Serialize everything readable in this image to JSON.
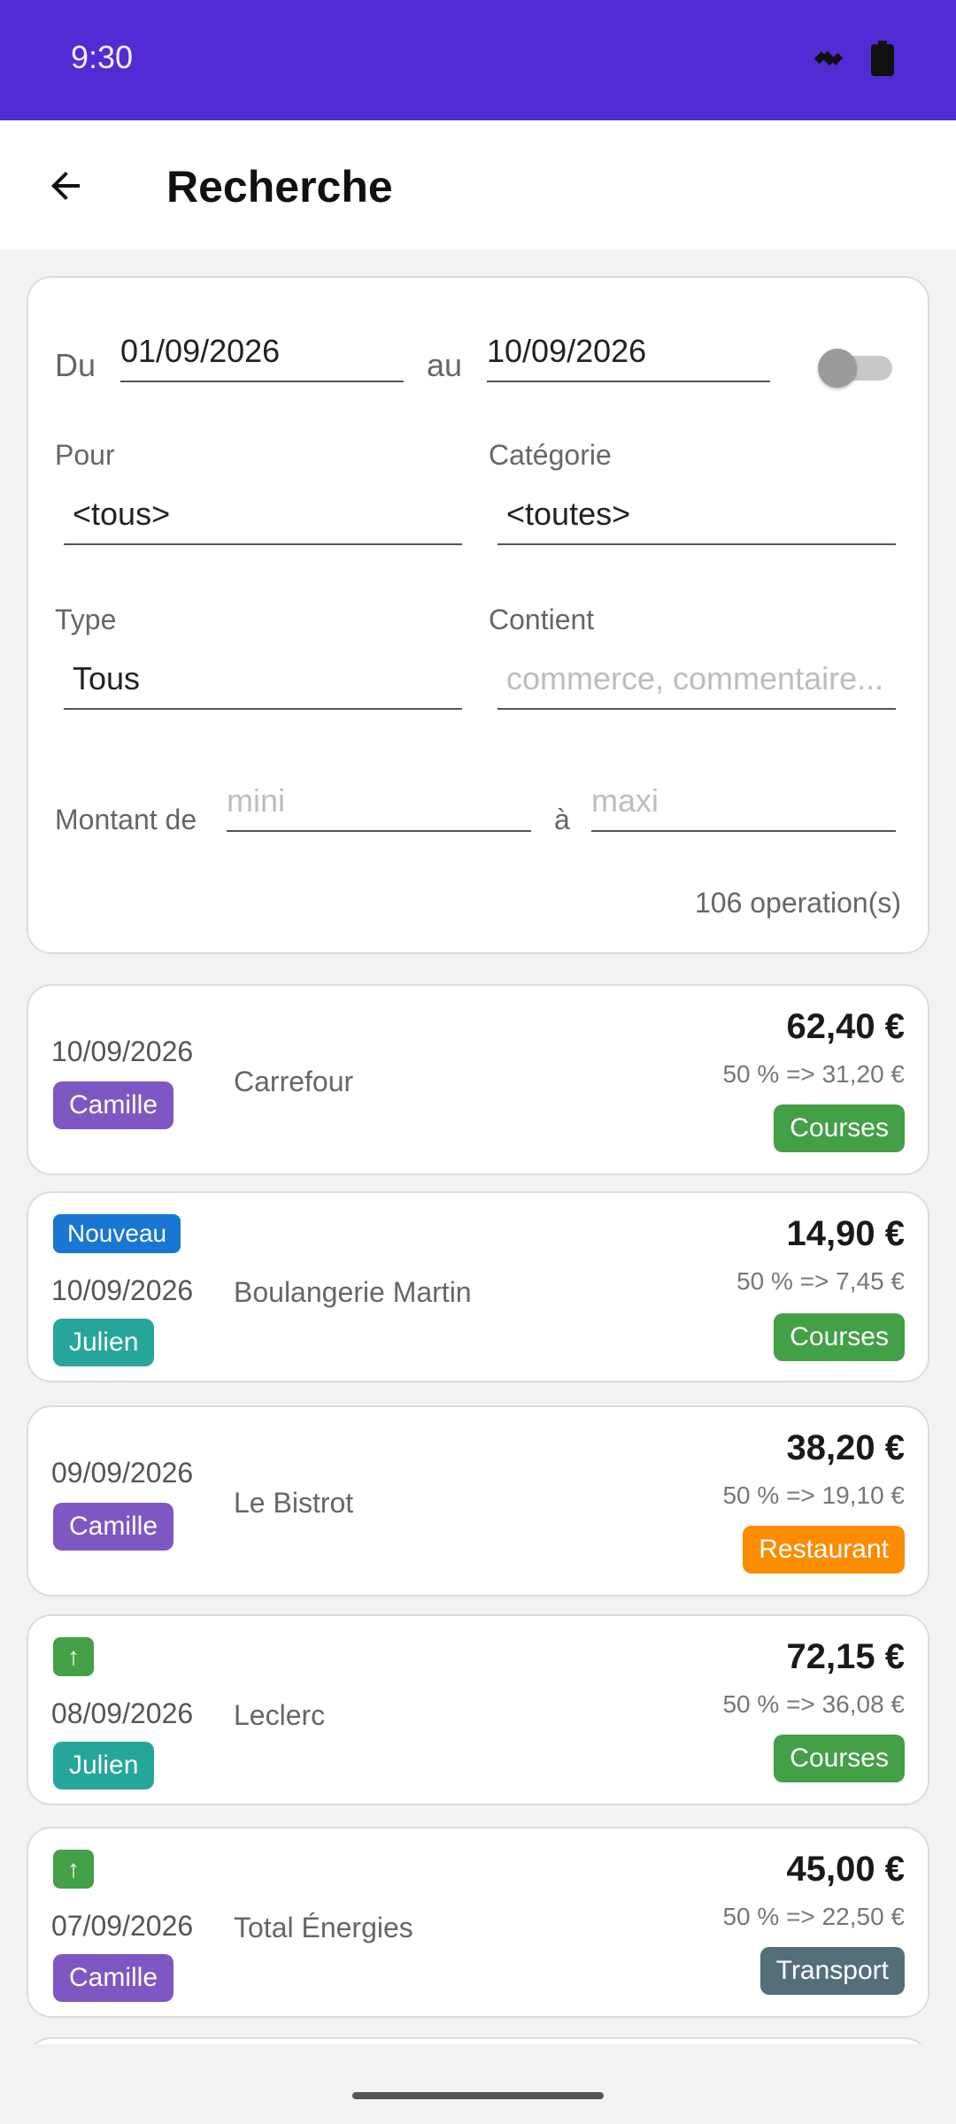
{
  "status": {
    "time": "9:30"
  },
  "appbar": {
    "title": "Recherche"
  },
  "filters": {
    "from_label": "Du",
    "from_value": "01/09/2026",
    "to_label": "au",
    "to_value": "10/09/2026",
    "for_label": "Pour",
    "for_value": "<tous>",
    "category_label": "Catégorie",
    "category_value": "<toutes>",
    "type_label": "Type",
    "type_value": "Tous",
    "contains_label": "Contient",
    "contains_placeholder": "commerce, commentaire...",
    "amount_label": "Montant de",
    "amount_min_placeholder": "mini",
    "amount_to_label": "à",
    "amount_max_placeholder": "maxi",
    "count": "106 operation(s)",
    "toggle_on": false
  },
  "colors": {
    "status_bar": "#512bd4",
    "camille": "#7e57c2",
    "julien": "#26a69a",
    "courses": "#43a047",
    "restaurant": "#fb8c00",
    "transport": "#546e7a",
    "nouveau": "#1976d2",
    "up": "#43a047"
  },
  "operations": [
    {
      "date": "10/09/2026",
      "who": "Camille",
      "shop": "Carrefour",
      "amount": "62,40 €",
      "share": "50 % => 31,20 €",
      "category": "Courses"
    },
    {
      "badge": "Nouveau",
      "date": "10/09/2026",
      "who": "Julien",
      "shop": "Boulangerie Martin",
      "amount": "14,90 €",
      "share": "50 % => 7,45 €",
      "category": "Courses"
    },
    {
      "date": "09/09/2026",
      "who": "Camille",
      "shop": "Le Bistrot",
      "amount": "38,20 €",
      "share": "50 % => 19,10 €",
      "category": "Restaurant"
    },
    {
      "badge": "↑",
      "date": "08/09/2026",
      "who": "Julien",
      "shop": "Leclerc",
      "amount": "72,15 €",
      "share": "50 % => 36,08 €",
      "category": "Courses"
    },
    {
      "badge": "↑",
      "date": "07/09/2026",
      "who": "Camille",
      "shop": "Total Énergies",
      "amount": "45,00 €",
      "share": "50 % => 22,50 €",
      "category": "Transport"
    }
  ]
}
